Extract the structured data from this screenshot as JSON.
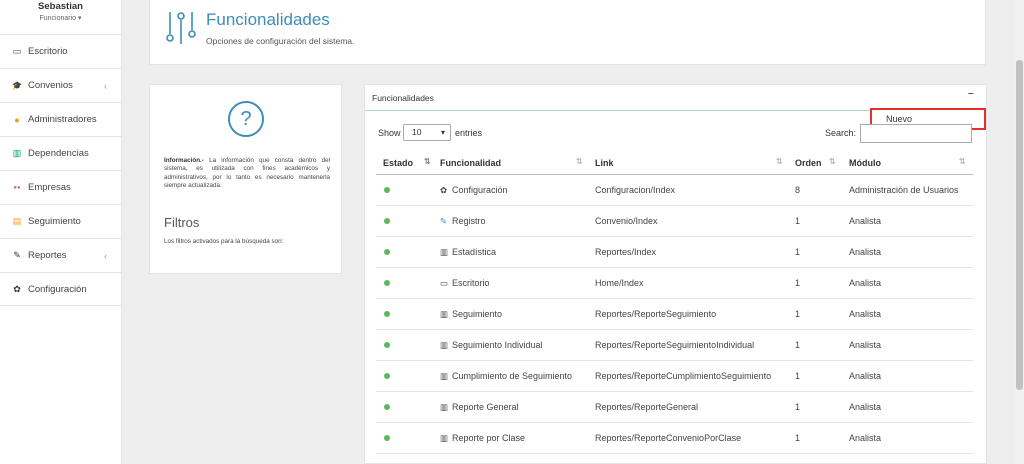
{
  "user": {
    "name": "Sebastian",
    "role": "Funcionario ▾"
  },
  "sidebar": {
    "items": [
      {
        "label": "Escritorio",
        "icon": "monitor-icon",
        "color": "#444444",
        "chevron": false
      },
      {
        "label": "Convenios",
        "icon": "graduation-cap-icon",
        "color": "#3c8dbc",
        "chevron": true
      },
      {
        "label": "Administradores",
        "icon": "user-icon",
        "color": "#f39c12",
        "chevron": false
      },
      {
        "label": "Dependencias",
        "icon": "bank-icon",
        "color": "#00a65a",
        "chevron": false
      },
      {
        "label": "Empresas",
        "icon": "users-icon",
        "color": "#c060c0",
        "chevron": false
      },
      {
        "label": "Seguimiento",
        "icon": "list-icon",
        "color": "#f39c12",
        "chevron": false
      },
      {
        "label": "Reportes",
        "icon": "pencil-icon",
        "color": "#333333",
        "chevron": true
      },
      {
        "label": "Configuración",
        "icon": "gear-icon",
        "color": "#333333",
        "chevron": false
      }
    ],
    "chevron_glyph": "‹"
  },
  "header": {
    "title": "Funcionalidades",
    "subtitle": "Opciones de configuración del sistema."
  },
  "info": {
    "icon_glyph": "?",
    "label": "Información.-",
    "text": " La información que consta dentro del sistema, es utilizada con fines académicos y administrativos, por lo tanto es necesario mantenerla siempre actualizada.",
    "filters_title": "Filtros",
    "filters_text": "Los filtros activados para la búsqueda son:"
  },
  "panel": {
    "title": "Funcionalidades",
    "collapse_label": "–",
    "dropdown_item": "Nuevo",
    "show_label": "Show",
    "page_size": "10",
    "entries_label": "entries",
    "search_label": "Search:"
  },
  "table": {
    "columns": [
      "Estado",
      "Funcionalidad",
      "Link",
      "Orden",
      "Módulo"
    ],
    "rows": [
      {
        "icon": "gear-icon",
        "glyph": "✿",
        "blue": false,
        "name": "Configuración",
        "link": "Configuracion/Index",
        "order": "8",
        "module": "Administración de Usuarios"
      },
      {
        "icon": "edit-icon",
        "glyph": "✎",
        "blue": true,
        "name": "Registro",
        "link": "Convenio/Index",
        "order": "1",
        "module": "Analista"
      },
      {
        "icon": "bar-chart-icon",
        "glyph": "▥",
        "blue": false,
        "name": "Estadística",
        "link": "Reportes/Index",
        "order": "1",
        "module": "Analista"
      },
      {
        "icon": "monitor-icon",
        "glyph": "▭",
        "blue": false,
        "name": "Escritorio",
        "link": "Home/Index",
        "order": "1",
        "module": "Analista"
      },
      {
        "icon": "bar-chart-icon",
        "glyph": "▥",
        "blue": false,
        "name": "Seguimiento",
        "link": "Reportes/ReporteSeguimiento",
        "order": "1",
        "module": "Analista"
      },
      {
        "icon": "bar-chart-icon",
        "glyph": "▥",
        "blue": false,
        "name": "Seguimiento Individual",
        "link": "Reportes/ReporteSeguimientoIndividual",
        "order": "1",
        "module": "Analista"
      },
      {
        "icon": "bar-chart-icon",
        "glyph": "▥",
        "blue": false,
        "name": "Cumplimiento de Seguimiento",
        "link": "Reportes/ReporteCumplimientoSeguimiento",
        "order": "1",
        "module": "Analista"
      },
      {
        "icon": "bar-chart-icon",
        "glyph": "▥",
        "blue": false,
        "name": "Reporte General",
        "link": "Reportes/ReporteGeneral",
        "order": "1",
        "module": "Analista"
      },
      {
        "icon": "bar-chart-icon",
        "glyph": "▥",
        "blue": false,
        "name": "Reporte por Clase",
        "link": "Reportes/ReporteConvenioPorClase",
        "order": "1",
        "module": "Analista"
      }
    ]
  },
  "colors": {
    "accent": "#3c8dbc",
    "status_active": "#5cb85c",
    "highlight_border": "#e03030"
  }
}
